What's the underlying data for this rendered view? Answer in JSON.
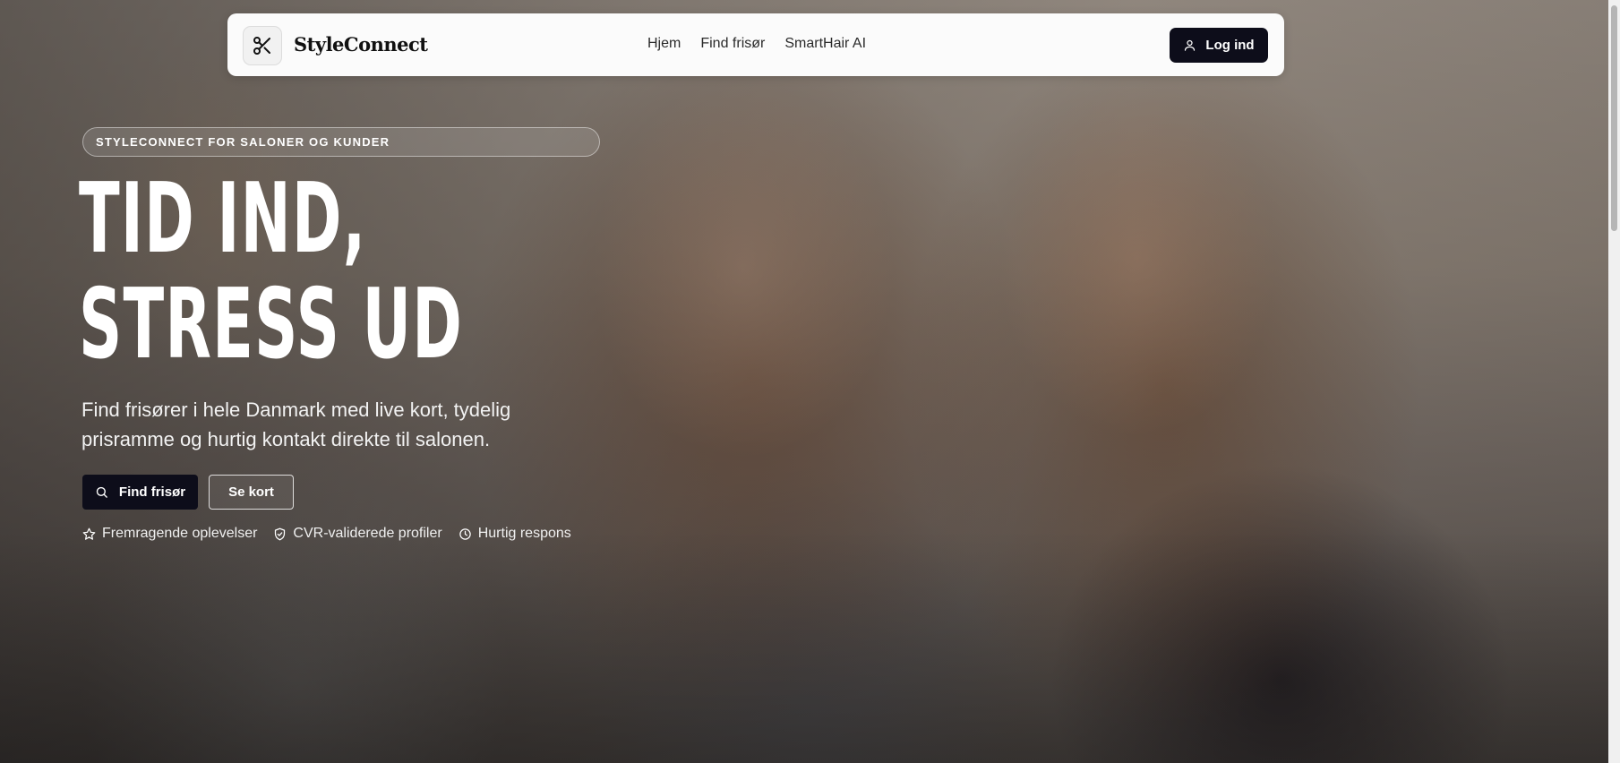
{
  "navbar": {
    "brand": "StyleConnect",
    "links": [
      "Hjem",
      "Find frisør",
      "SmartHair AI"
    ],
    "login_label": "Log ind"
  },
  "hero": {
    "eyebrow": "STYLECONNECT FOR SALONER OG KUNDER",
    "headline_line1": "TID IND,",
    "headline_line2": "STRESS UD",
    "subtitle": "Find frisører i hele Danmark med live kort, tydelig prisramme og hurtig kontakt direkte til salonen.",
    "primary_button": "Find frisør",
    "secondary_button": "Se kort",
    "features": [
      {
        "icon": "star-icon",
        "label": "Fremragende oplevelser"
      },
      {
        "icon": "shield-check-icon",
        "label": "CVR-validerede profiler"
      },
      {
        "icon": "clock-icon",
        "label": "Hurtig respons"
      }
    ]
  },
  "colors": {
    "dark_button": "#0d0d1a",
    "navbar_bg": "#fbfbfb",
    "text_light": "#ffffff"
  }
}
